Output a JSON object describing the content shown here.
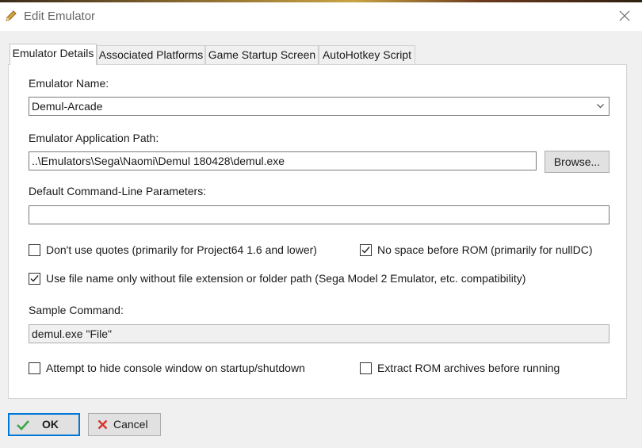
{
  "window": {
    "title": "Edit Emulator"
  },
  "tabs": [
    {
      "label": "Emulator Details"
    },
    {
      "label": "Associated Platforms"
    },
    {
      "label": "Game Startup Screen"
    },
    {
      "label": "AutoHotkey Script"
    }
  ],
  "emulator_name": {
    "label": "Emulator Name:",
    "value": "Demul-Arcade"
  },
  "app_path": {
    "label": "Emulator Application Path:",
    "value": "..\\Emulators\\Sega\\Naomi\\Demul 180428\\demul.exe",
    "browse_label": "Browse..."
  },
  "cmd_params": {
    "label": "Default Command-Line Parameters:",
    "value": ""
  },
  "options": {
    "dont_use_quotes": {
      "label": "Don't use quotes (primarily for Project64 1.6 and lower)",
      "checked": false
    },
    "no_space_before_rom": {
      "label": "No space before ROM (primarily for nullDC)",
      "checked": true
    },
    "file_name_only": {
      "label": "Use file name only without file extension or folder path (Sega Model 2 Emulator, etc. compatibility)",
      "checked": true
    },
    "hide_console": {
      "label": "Attempt to hide console window on startup/shutdown",
      "checked": false
    },
    "extract_rom": {
      "label": "Extract ROM archives before running",
      "checked": false
    }
  },
  "sample_command": {
    "label": "Sample Command:",
    "value": "demul.exe \"File\""
  },
  "buttons": {
    "ok": "OK",
    "cancel": "Cancel"
  },
  "colors": {
    "ok_check": "#3aa64a",
    "cancel_x": "#d9342b",
    "focus_border": "#0078d7"
  },
  "icons": {
    "title": "pencil-icon",
    "close": "close-icon",
    "ok": "checkmark-icon",
    "cancel": "x-icon"
  }
}
